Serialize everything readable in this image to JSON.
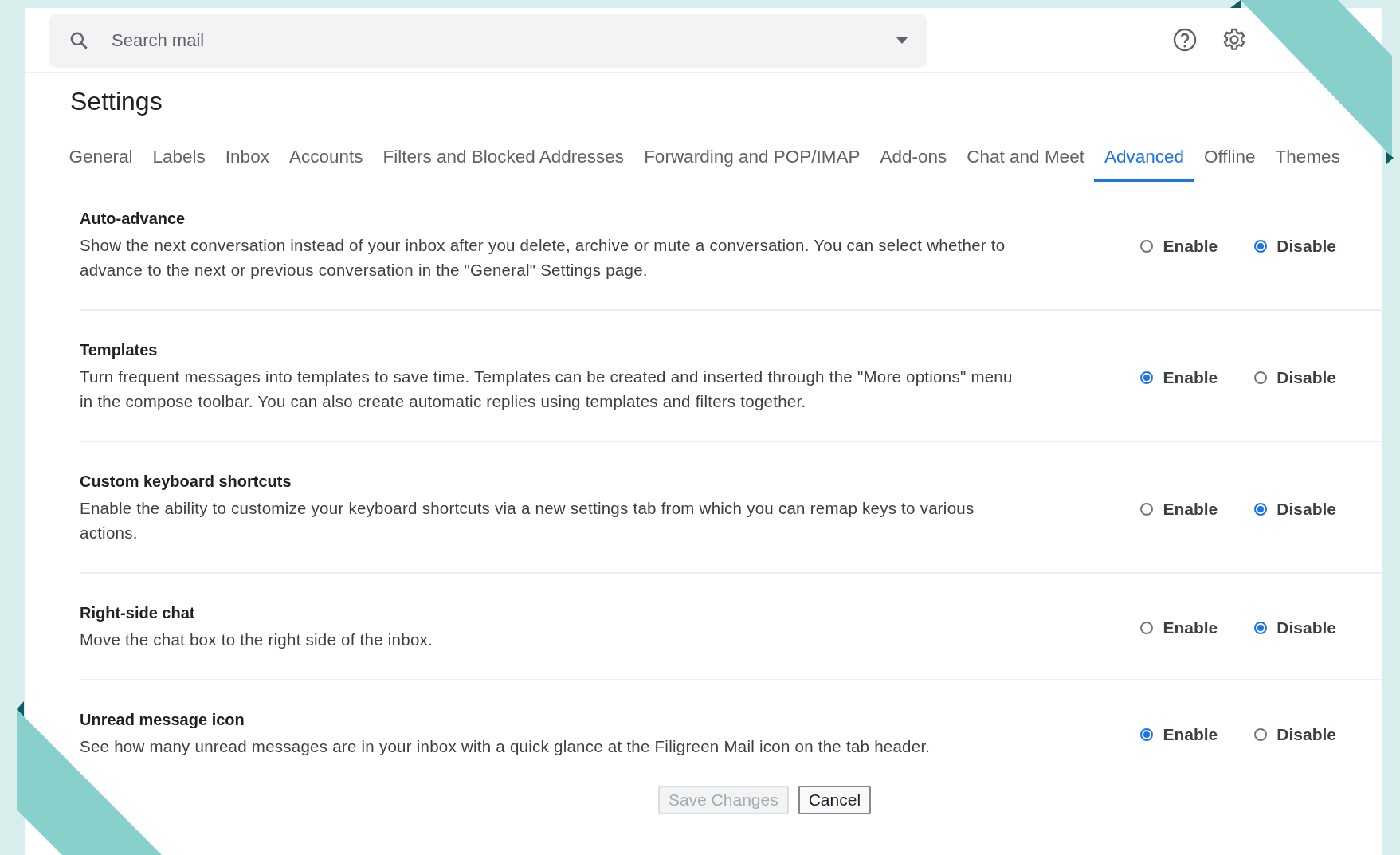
{
  "search": {
    "placeholder": "Search mail"
  },
  "title": "Settings",
  "tabs": [
    {
      "label": "General",
      "selected": false
    },
    {
      "label": "Labels",
      "selected": false
    },
    {
      "label": "Inbox",
      "selected": false
    },
    {
      "label": "Accounts",
      "selected": false
    },
    {
      "label": "Filters and Blocked Addresses",
      "selected": false
    },
    {
      "label": "Forwarding and POP/IMAP",
      "selected": false
    },
    {
      "label": "Add-ons",
      "selected": false
    },
    {
      "label": "Chat and Meet",
      "selected": false
    },
    {
      "label": "Advanced",
      "selected": true
    },
    {
      "label": "Offline",
      "selected": false
    },
    {
      "label": "Themes",
      "selected": false
    }
  ],
  "sections": [
    {
      "title": "Auto-advance",
      "description": "Show the next conversation instead of your inbox after you delete, archive or mute a conversation. You can select whether to advance to the next or previous conversation in the \"General\" Settings page.",
      "options": [
        {
          "label": "Enable",
          "selected": false
        },
        {
          "label": "Disable",
          "selected": true
        }
      ]
    },
    {
      "title": "Templates",
      "description": "Turn frequent messages into templates to save time. Templates can be created and inserted through the \"More options\" menu in the compose toolbar. You can also create automatic replies using templates and filters together.",
      "options": [
        {
          "label": "Enable",
          "selected": true
        },
        {
          "label": "Disable",
          "selected": false
        }
      ]
    },
    {
      "title": "Custom keyboard shortcuts",
      "description": "Enable the ability to customize your keyboard shortcuts via a new settings tab from which you can remap keys to various actions.",
      "options": [
        {
          "label": "Enable",
          "selected": false
        },
        {
          "label": "Disable",
          "selected": true
        }
      ]
    },
    {
      "title": "Right-side chat",
      "description": "Move the chat box to the right side of the inbox.",
      "options": [
        {
          "label": "Enable",
          "selected": false
        },
        {
          "label": "Disable",
          "selected": true
        }
      ]
    },
    {
      "title": "Unread message icon",
      "description": "See how many unread messages are in your inbox with a quick glance at the Filigreen Mail icon on the tab header.",
      "options": [
        {
          "label": "Enable",
          "selected": true
        },
        {
          "label": "Disable",
          "selected": false
        }
      ]
    }
  ],
  "buttons": [
    {
      "label": "Save Changes",
      "disabled": true
    },
    {
      "label": "Cancel",
      "disabled": false
    }
  ]
}
